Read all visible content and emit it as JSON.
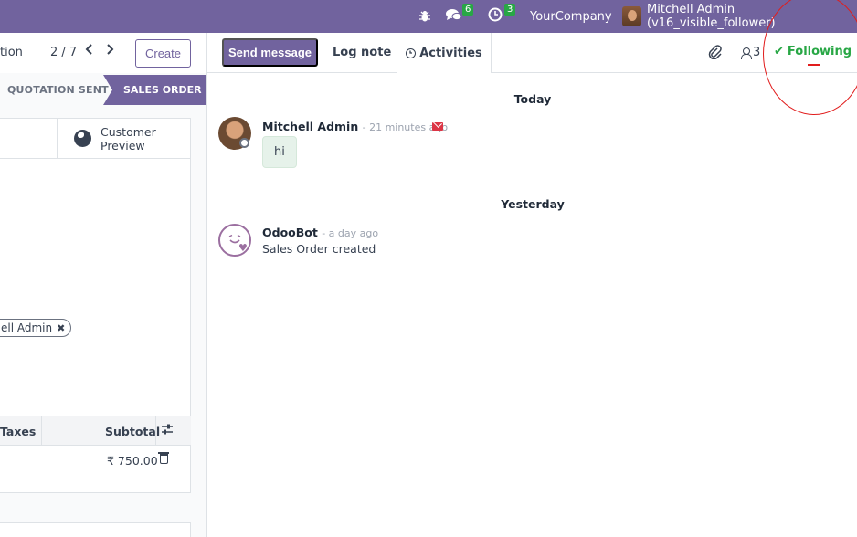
{
  "navbar": {
    "chat_badge": "6",
    "activity_badge": "3",
    "company": "YourCompany",
    "user": "Mitchell Admin (v16_visible_follower)"
  },
  "control_panel": {
    "title_fragment": "tion",
    "pager": "2 / 7",
    "create_label": "Create"
  },
  "statusbar": {
    "quotation_sent": "QUOTATION SENT",
    "sales_order": "SALES ORDER"
  },
  "form": {
    "smart_button_line1": "Customer",
    "smart_button_line2": "Preview",
    "tag_label": "ell Admin",
    "tag_remove": "✖"
  },
  "order_lines": {
    "col_taxes": "Taxes",
    "col_subtotal": "Subtotal",
    "row_subtotal": "₹ 750.00"
  },
  "chatter": {
    "send_message": "Send message",
    "log_note": "Log note",
    "activities": "Activities",
    "follower_count": "3",
    "following": "Following",
    "groups": [
      {
        "date": "Today",
        "author": "Mitchell Admin",
        "time": "- 21 minutes ago",
        "body": "hi"
      },
      {
        "date": "Yesterday",
        "author": "OdooBot",
        "time": "- a day ago",
        "body": "Sales Order created"
      }
    ]
  },
  "colors": {
    "brand": "#71639e",
    "following": "#28a745",
    "highlight": "#e11d1d"
  }
}
